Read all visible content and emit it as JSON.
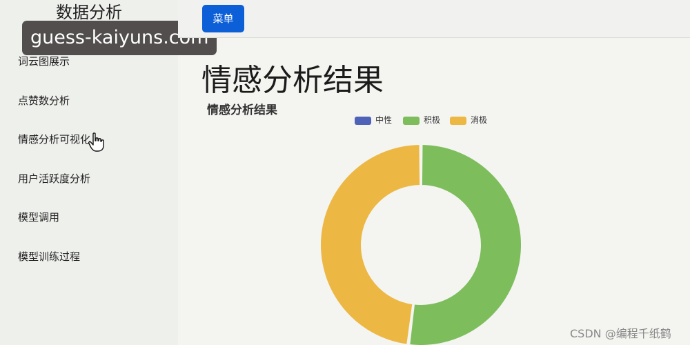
{
  "sidebar": {
    "brand": "数据分析",
    "items": [
      {
        "label": "词云图展示"
      },
      {
        "label": "点赞数分析"
      },
      {
        "label": "情感分析可视化"
      },
      {
        "label": "用户活跃度分析"
      },
      {
        "label": "模型调用"
      },
      {
        "label": "模型训练过程"
      }
    ]
  },
  "overlay": {
    "url_text": "guess-kaiyuns.com"
  },
  "topbar": {
    "menu_label": "菜单"
  },
  "main": {
    "page_title": "情感分析结果"
  },
  "watermark": {
    "csdn": "CSDN @编程千纸鹤"
  },
  "colors": {
    "neutral": "#4e63b8",
    "positive": "#7dbd5c",
    "negative": "#ecb843",
    "menu_button": "#0d5fd8"
  },
  "chart_data": {
    "type": "pie",
    "variant": "donut",
    "title": "情感分析结果",
    "legend_position": "top",
    "series": [
      {
        "name": "中性",
        "value": 0,
        "color": "#4e63b8"
      },
      {
        "name": "积极",
        "value": 52,
        "color": "#7dbd5c"
      },
      {
        "name": "消极",
        "value": 48,
        "color": "#ecb843"
      }
    ]
  }
}
